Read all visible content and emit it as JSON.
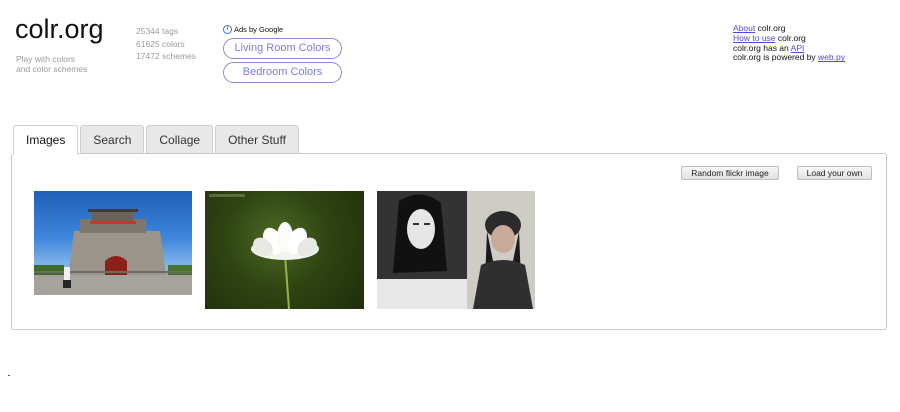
{
  "header": {
    "logo": "colr.org",
    "tagline_line1": "Play with colors",
    "tagline_line2": "and color schemes",
    "stats": {
      "tags": "25344 tags",
      "colors": "61625 colors",
      "schemes": "17472 schemes"
    }
  },
  "ads": {
    "label": "Ads by Google",
    "buttons": [
      "Living Room Colors",
      "Bedroom Colors"
    ]
  },
  "about": {
    "line1_link": "About",
    "line1_text": " colr.org",
    "line2_link": "How to use",
    "line2_text": " colr.org",
    "line3_text": "colr.org has an ",
    "line3_link": "API",
    "line4_text": "colr.org is powered by ",
    "line4_link": "web.py"
  },
  "tabs": [
    "Images",
    "Search",
    "Collage",
    "Other Stuff"
  ],
  "active_tab": "Images",
  "panel": {
    "random_button": "Random flickr image",
    "load_button": "Load your own"
  },
  "images": [
    {
      "icon": "bell-tower-photo"
    },
    {
      "icon": "white-flower-photo"
    },
    {
      "icon": "dark-haired-figures-photo"
    }
  ],
  "colors": {
    "link": "#4c4ce0",
    "ad_border": "#8a8ad6",
    "ad_text": "#7e7edb",
    "muted_text": "#9a9a9a"
  }
}
